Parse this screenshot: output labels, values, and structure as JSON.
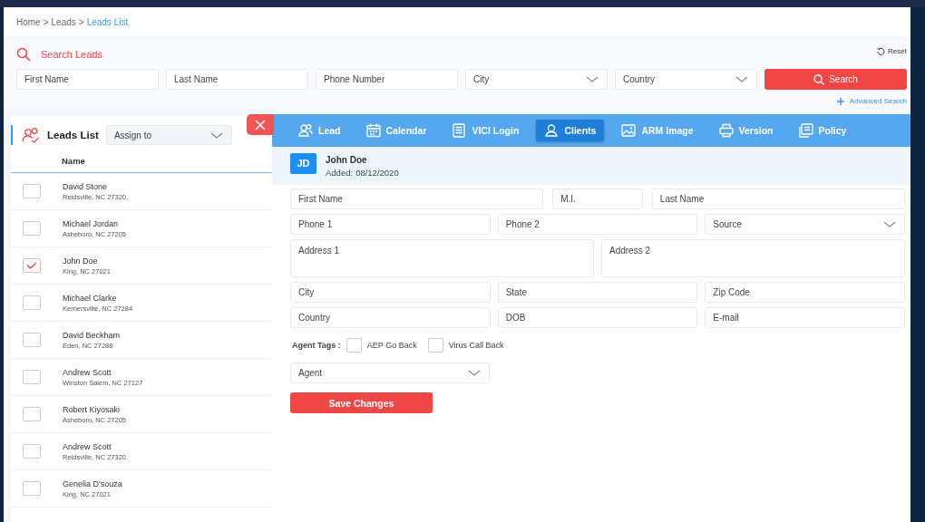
{
  "breadcrumb_separator": ">",
  "breadcrumb": [
    {
      "label": "Home",
      "selected": false
    },
    {
      "label": "Leads",
      "selected": false
    },
    {
      "label": "Leads List",
      "selected": true
    }
  ],
  "search": {
    "title": "Search Leads",
    "reset": "Reset",
    "fields": [
      {
        "kind": "input",
        "placeholder": "First Name"
      },
      {
        "kind": "input",
        "placeholder": "Last Name"
      },
      {
        "kind": "input",
        "placeholder": "Phone Number"
      },
      {
        "kind": "select",
        "placeholder": "City"
      },
      {
        "kind": "select",
        "placeholder": "Country"
      }
    ],
    "button": "Search",
    "advanced": "Advanced Search"
  },
  "leads": {
    "title": "Leads List",
    "assign_placeholder": "Assign to",
    "column": "Name",
    "rows": [
      {
        "name": "David Stone",
        "address": "Reidsville, NC 27320.",
        "checked": false
      },
      {
        "name": "Michael Jordan",
        "address": "Asheboro, NC 27205",
        "checked": false
      },
      {
        "name": "John Doe",
        "address": "King, NC 27021",
        "checked": true
      },
      {
        "name": "Michael Clarke",
        "address": "Kernersville, NC 27284",
        "checked": false
      },
      {
        "name": "David Beckham",
        "address": "Eden, NC 27288",
        "checked": false
      },
      {
        "name": "Andrew Scott",
        "address": "Winston Salem, NC 27127",
        "checked": false
      },
      {
        "name": "Robert Kiyosaki",
        "address": "Asheboro, NC 27205",
        "checked": false
      },
      {
        "name": "Andrew Scott",
        "address": "Reidsville, NC 27320.",
        "checked": false
      },
      {
        "name": "Genelia D'souza",
        "address": "King, NC 27021",
        "checked": false
      }
    ]
  },
  "client": {
    "tabs": [
      {
        "label": "Lead",
        "selected": false
      },
      {
        "label": "Calendar",
        "selected": false
      },
      {
        "label": "VICI Login",
        "selected": false
      },
      {
        "label": "Clients",
        "selected": true
      },
      {
        "label": "ARM Image",
        "selected": false
      },
      {
        "label": "Version",
        "selected": false
      },
      {
        "label": "Policy",
        "selected": false
      }
    ],
    "avatar": "JD",
    "name": "John Doe",
    "added_label": "Added:",
    "added_date": "08/12/2020",
    "form_rows": [
      [
        {
          "kind": "input",
          "placeholder": "First Name"
        },
        {
          "kind": "input",
          "placeholder": "M.I."
        },
        {
          "kind": "input",
          "placeholder": "Last Name"
        }
      ],
      [
        {
          "kind": "input",
          "placeholder": "Phone 1"
        },
        {
          "kind": "input",
          "placeholder": "Phone 2"
        },
        {
          "kind": "select",
          "placeholder": "Source"
        }
      ],
      [
        {
          "kind": "textarea",
          "placeholder": "Address 1"
        },
        {
          "kind": "textarea",
          "placeholder": "Address 2"
        }
      ],
      [
        {
          "kind": "input",
          "placeholder": "City"
        },
        {
          "kind": "input",
          "placeholder": "State"
        },
        {
          "kind": "input",
          "placeholder": "Zip Code"
        }
      ],
      [
        {
          "kind": "input",
          "placeholder": "Country"
        },
        {
          "kind": "input",
          "placeholder": "DOB"
        },
        {
          "kind": "input",
          "placeholder": "E-mail"
        }
      ]
    ],
    "tags_label": "Agent Tags :",
    "tags": [
      {
        "label": "AEP Go Back",
        "checked": false
      },
      {
        "label": "Virus Call Back",
        "checked": false
      }
    ],
    "agent_placeholder": "Agent",
    "save": "Save Changes"
  }
}
